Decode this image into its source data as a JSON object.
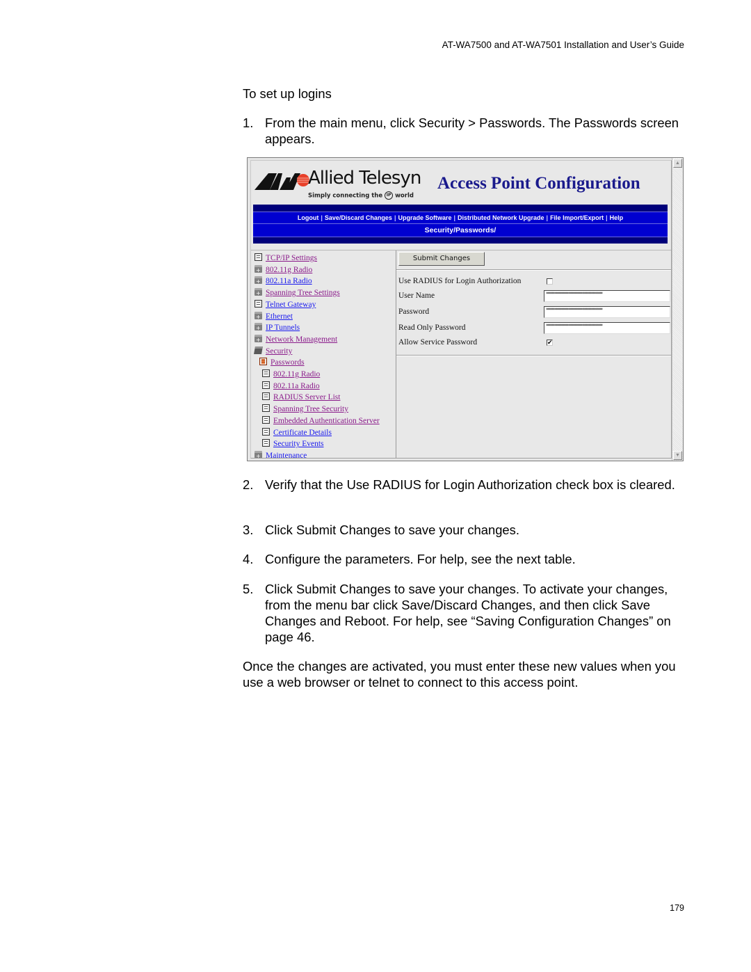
{
  "document": {
    "running_header": "AT-WA7500 and AT-WA7501 Installation and User’s Guide",
    "page_number": "179",
    "intro": "To set up logins",
    "steps": [
      {
        "num": "1.",
        "text": "From the main menu, click Security > Passwords. The Passwords screen appears."
      },
      {
        "num": "2.",
        "text": "Verify that the Use RADIUS for Login Authorization check box is cleared."
      },
      {
        "num": "3.",
        "text": "Click Submit Changes to save your changes."
      },
      {
        "num": "4.",
        "text": "Configure the parameters. For help, see the next table."
      },
      {
        "num": "5.",
        "text": "Click Submit Changes to save your changes. To activate your changes, from the menu bar click Save/Discard Changes, and then click Save Changes and Reboot. For help, see “Saving Configuration Changes” on page 46."
      }
    ],
    "closing": "Once the changes are activated, you must enter these new values when you use a web browser or telnet to connect to this access point."
  },
  "screenshot": {
    "logo": {
      "name": "Allied Telesyn",
      "tagline_pre": "Simply connecting the",
      "tagline_ip": "IP",
      "tagline_post": "world",
      "colors": {
        "mark": "#111111",
        "circle": "#e8402a"
      }
    },
    "app_title": "Access Point Configuration",
    "colors": {
      "nav_dark": "#00007a",
      "nav_bright": "#0000d0",
      "title": "#1a1a8c",
      "link_visited": "#8a1a8a",
      "link_unvisited": "#1a1aee"
    },
    "menu": [
      "Logout",
      "Save/Discard Changes",
      "Upgrade Software",
      "Distributed Network Upgrade",
      "File Import/Export",
      "Help"
    ],
    "breadcrumb": "Security/Passwords/",
    "tree": [
      {
        "label": "TCP/IP Settings",
        "icon": "document-icon",
        "level": 0,
        "visited": true
      },
      {
        "label": "802.11g Radio",
        "icon": "folder-icon",
        "level": 0,
        "visited": true
      },
      {
        "label": "802.11a Radio",
        "icon": "folder-icon",
        "level": 0,
        "visited": false
      },
      {
        "label": "Spanning Tree Settings",
        "icon": "folder-icon",
        "level": 0,
        "visited": true
      },
      {
        "label": "Telnet Gateway",
        "icon": "document-icon",
        "level": 0,
        "visited": false
      },
      {
        "label": "Ethernet",
        "icon": "folder-icon",
        "level": 0,
        "visited": false
      },
      {
        "label": "IP Tunnels",
        "icon": "folder-icon",
        "level": 0,
        "visited": false
      },
      {
        "label": "Network Management",
        "icon": "folder-icon",
        "level": 0,
        "visited": true
      },
      {
        "label": "Security",
        "icon": "folder-open-icon",
        "level": 0,
        "visited": true
      },
      {
        "label": "Passwords",
        "icon": "document-active-icon",
        "level": 1,
        "visited": true
      },
      {
        "label": "802.11g Radio",
        "icon": "document-icon",
        "level": 2,
        "visited": true
      },
      {
        "label": "802.11a Radio",
        "icon": "document-icon",
        "level": 2,
        "visited": true
      },
      {
        "label": "RADIUS Server List",
        "icon": "document-icon",
        "level": 2,
        "visited": true
      },
      {
        "label": "Spanning Tree Security",
        "icon": "document-icon",
        "level": 2,
        "visited": true
      },
      {
        "label": "Embedded Authentication Server",
        "icon": "document-icon",
        "level": 2,
        "visited": true
      },
      {
        "label": "Certificate Details",
        "icon": "document-icon",
        "level": 2,
        "visited": false
      },
      {
        "label": "Security Events",
        "icon": "document-icon",
        "level": 2,
        "visited": false
      },
      {
        "label": "Maintenance",
        "icon": "folder-icon",
        "level": 0,
        "visited": false
      }
    ],
    "form": {
      "submit_label": "Submit Changes",
      "fields": [
        {
          "label": "Use RADIUS for Login Authorization",
          "type": "checkbox",
          "checked": false
        },
        {
          "label": "User Name",
          "type": "text",
          "value": "****************************************"
        },
        {
          "label": "Password",
          "type": "text",
          "value": "****************************************"
        },
        {
          "label": "Read Only Password",
          "type": "text",
          "value": "****************************************"
        },
        {
          "label": "Allow Service Password",
          "type": "checkbox",
          "checked": true
        }
      ]
    }
  }
}
